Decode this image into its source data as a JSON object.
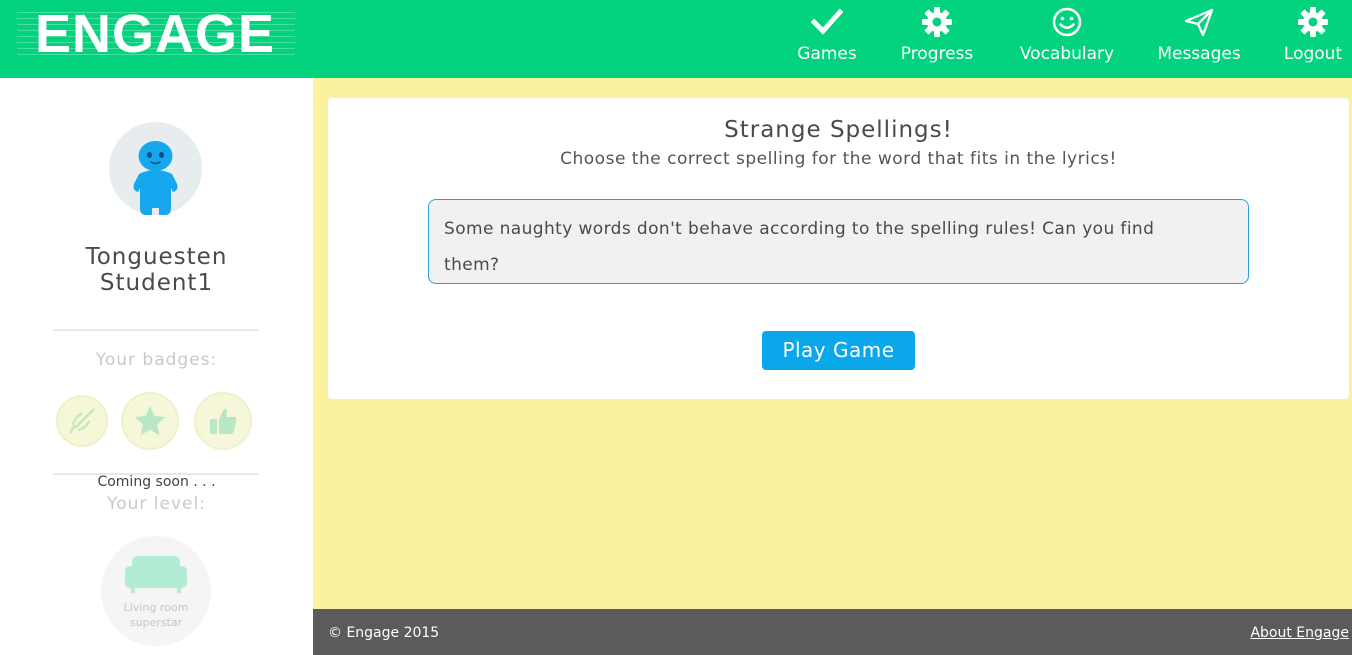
{
  "header": {
    "logo_text": "ENGAGE",
    "nav": [
      {
        "label": "Games",
        "icon": "check-icon"
      },
      {
        "label": "Progress",
        "icon": "gear-icon"
      },
      {
        "label": "Vocabulary",
        "icon": "smiley-icon"
      },
      {
        "label": "Messages",
        "icon": "paper-plane-icon"
      },
      {
        "label": "Logout",
        "icon": "gear-icon"
      }
    ]
  },
  "sidebar": {
    "student_name_line1": "Tonguesten",
    "student_name_line2": "Student1",
    "badges_title": "Your badges:",
    "badges": [
      {
        "icon": "rocket-icon"
      },
      {
        "icon": "star-icon"
      },
      {
        "icon": "thumbs-up-icon"
      }
    ],
    "coming_soon": "Coming soon . . .",
    "level_title": "Your level:",
    "level_name_line1": "Living room",
    "level_name_line2": "superstar",
    "level_icon": "sofa-icon"
  },
  "main": {
    "title": "Strange Spellings!",
    "subtitle": "Choose the correct spelling for the word that fits in the lyrics!",
    "description_line1": "Some naughty words don't behave according to the spelling rules! Can you find",
    "description_line2": "them?",
    "play_button": "Play Game"
  },
  "footer": {
    "copyright": "© Engage 2015",
    "about_link": "About Engage"
  },
  "colors": {
    "header_bg": "#03d27f",
    "main_bg": "#faf29e",
    "button_bg": "#0aa7ea",
    "footer_bg": "#5c5a5b",
    "avatar_color": "#17a7ee"
  }
}
